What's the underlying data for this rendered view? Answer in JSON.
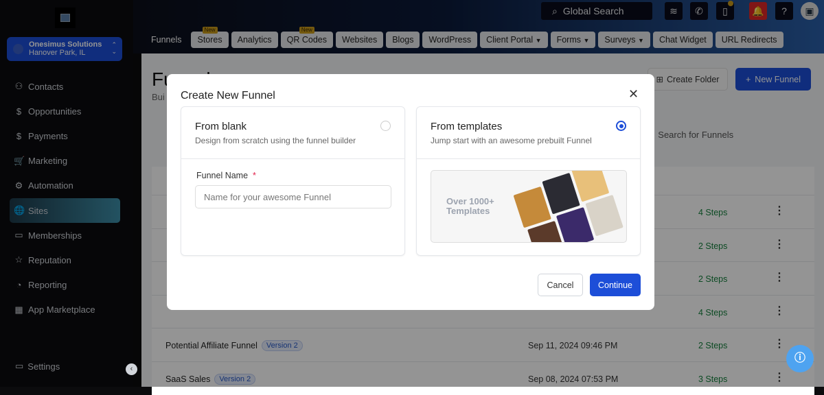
{
  "account": {
    "name": "Onesimus Solutions",
    "location": "Hanover Park, IL"
  },
  "sidebar": {
    "items": [
      {
        "label": "Contacts",
        "icon": "contacts-icon",
        "glyph": "⚇"
      },
      {
        "label": "Opportunities",
        "icon": "dollar-circle-icon",
        "glyph": "$"
      },
      {
        "label": "Payments",
        "icon": "dollar-icon",
        "glyph": "$"
      },
      {
        "label": "Marketing",
        "icon": "cart-icon",
        "glyph": "🛒"
      },
      {
        "label": "Automation",
        "icon": "briefcase-icon",
        "glyph": "⚙"
      },
      {
        "label": "Sites",
        "icon": "globe-icon",
        "glyph": "🌐",
        "active": true
      },
      {
        "label": "Memberships",
        "icon": "monitor-icon",
        "glyph": "▭"
      },
      {
        "label": "Reputation",
        "icon": "star-box-icon",
        "glyph": "☆"
      },
      {
        "label": "Reporting",
        "icon": "chart-icon",
        "glyph": "◔"
      },
      {
        "label": "App Marketplace",
        "icon": "grid-icon",
        "glyph": "▦"
      }
    ],
    "settings": "Settings"
  },
  "topbar": {
    "search": "Global Search"
  },
  "tabs": [
    {
      "label": "Funnels",
      "plain": true
    },
    {
      "label": "Stores",
      "badge": "New"
    },
    {
      "label": "Analytics"
    },
    {
      "label": "QR Codes",
      "badge": "New"
    },
    {
      "label": "Websites"
    },
    {
      "label": "Blogs"
    },
    {
      "label": "WordPress"
    },
    {
      "label": "Client Portal",
      "dropdown": true
    },
    {
      "label": "Forms",
      "dropdown": true
    },
    {
      "label": "Surveys",
      "dropdown": true
    },
    {
      "label": "Chat Widget"
    },
    {
      "label": "URL Redirects"
    }
  ],
  "page": {
    "title": "Funnels",
    "subtitle": "Bui",
    "create_folder": "Create Folder",
    "new_funnel": "New Funnel",
    "search_placeholder": "Search for Funnels"
  },
  "table": {
    "rows": [
      {
        "name": "",
        "version": "",
        "date": "",
        "steps": "4 Steps"
      },
      {
        "name": "",
        "version": "",
        "date": "",
        "steps": "2 Steps"
      },
      {
        "name": "",
        "version": "",
        "date": "",
        "steps": "2 Steps"
      },
      {
        "name": "",
        "version": "",
        "date": "",
        "steps": "4 Steps"
      },
      {
        "name": "Potential Affiliate Funnel",
        "version": "Version 2",
        "date": "Sep 11, 2024 09:46 PM",
        "steps": "2 Steps"
      },
      {
        "name": "SaaS Sales",
        "version": "Version 2",
        "date": "Sep 08, 2024 07:53 PM",
        "steps": "3 Steps"
      }
    ]
  },
  "modal": {
    "title": "Create New Funnel",
    "blank": {
      "title": "From blank",
      "desc": "Design from scratch using the funnel builder",
      "selected": false
    },
    "templates": {
      "title": "From templates",
      "desc": "Jump start with an awesome prebuilt Funnel",
      "selected": true,
      "preview_text": "Over 1000+ Templates"
    },
    "field_label": "Funnel Name",
    "required_mark": "*",
    "field_placeholder": "Name for your awesome Funnel",
    "field_value": "",
    "cancel": "Cancel",
    "continue": "Continue"
  },
  "colors": {
    "primary": "#1d4ed8",
    "steps": "#15803d",
    "badge": "#c99a1a",
    "alert": "#dc2626"
  }
}
